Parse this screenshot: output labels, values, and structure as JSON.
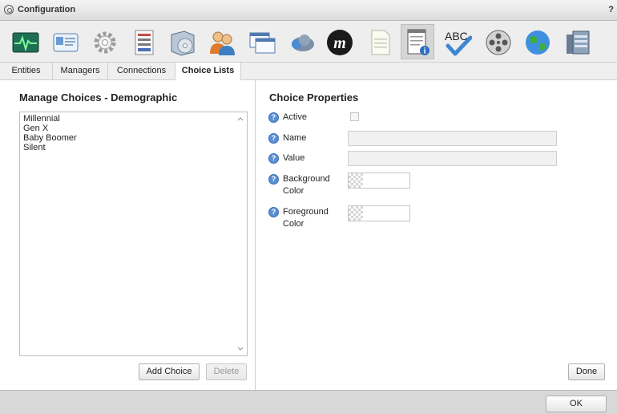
{
  "window": {
    "title": "Configuration",
    "help_label": "?"
  },
  "toolbar": {
    "icons": [
      "activity-monitor-icon",
      "id-card-icon",
      "gear-icon",
      "server-rack-icon",
      "software-box-icon",
      "users-icon",
      "windows-icon",
      "cloud-icon",
      "m-logo-icon",
      "document-icon",
      "notepad-info-icon",
      "spellcheck-abc-icon",
      "film-reel-icon",
      "globe-icon",
      "database-icon"
    ],
    "selected": "notepad-info-icon"
  },
  "tabs": [
    {
      "label": "Entities",
      "active": false
    },
    {
      "label": "Managers",
      "active": false
    },
    {
      "label": "Connections",
      "active": false
    },
    {
      "label": "Choice Lists",
      "active": true
    }
  ],
  "left": {
    "title": "Manage Choices - Demographic",
    "choices": [
      "Millennial",
      "Gen X",
      "Baby Boomer",
      "Silent"
    ],
    "add_label": "Add Choice",
    "delete_label": "Delete"
  },
  "right": {
    "title": "Choice Properties",
    "active_label": "Active",
    "active_checked": false,
    "name_label": "Name",
    "name_value": "",
    "value_label": "Value",
    "value_value": "",
    "background_label_1": "Background",
    "background_label_2": "Color",
    "foreground_label_1": "Foreground",
    "foreground_label_2": "Color",
    "done_label": "Done"
  },
  "footer": {
    "ok_label": "OK"
  },
  "colors": {
    "help_icon": "#5a8fd6",
    "toolbar_selected": "#d6d6d6"
  }
}
